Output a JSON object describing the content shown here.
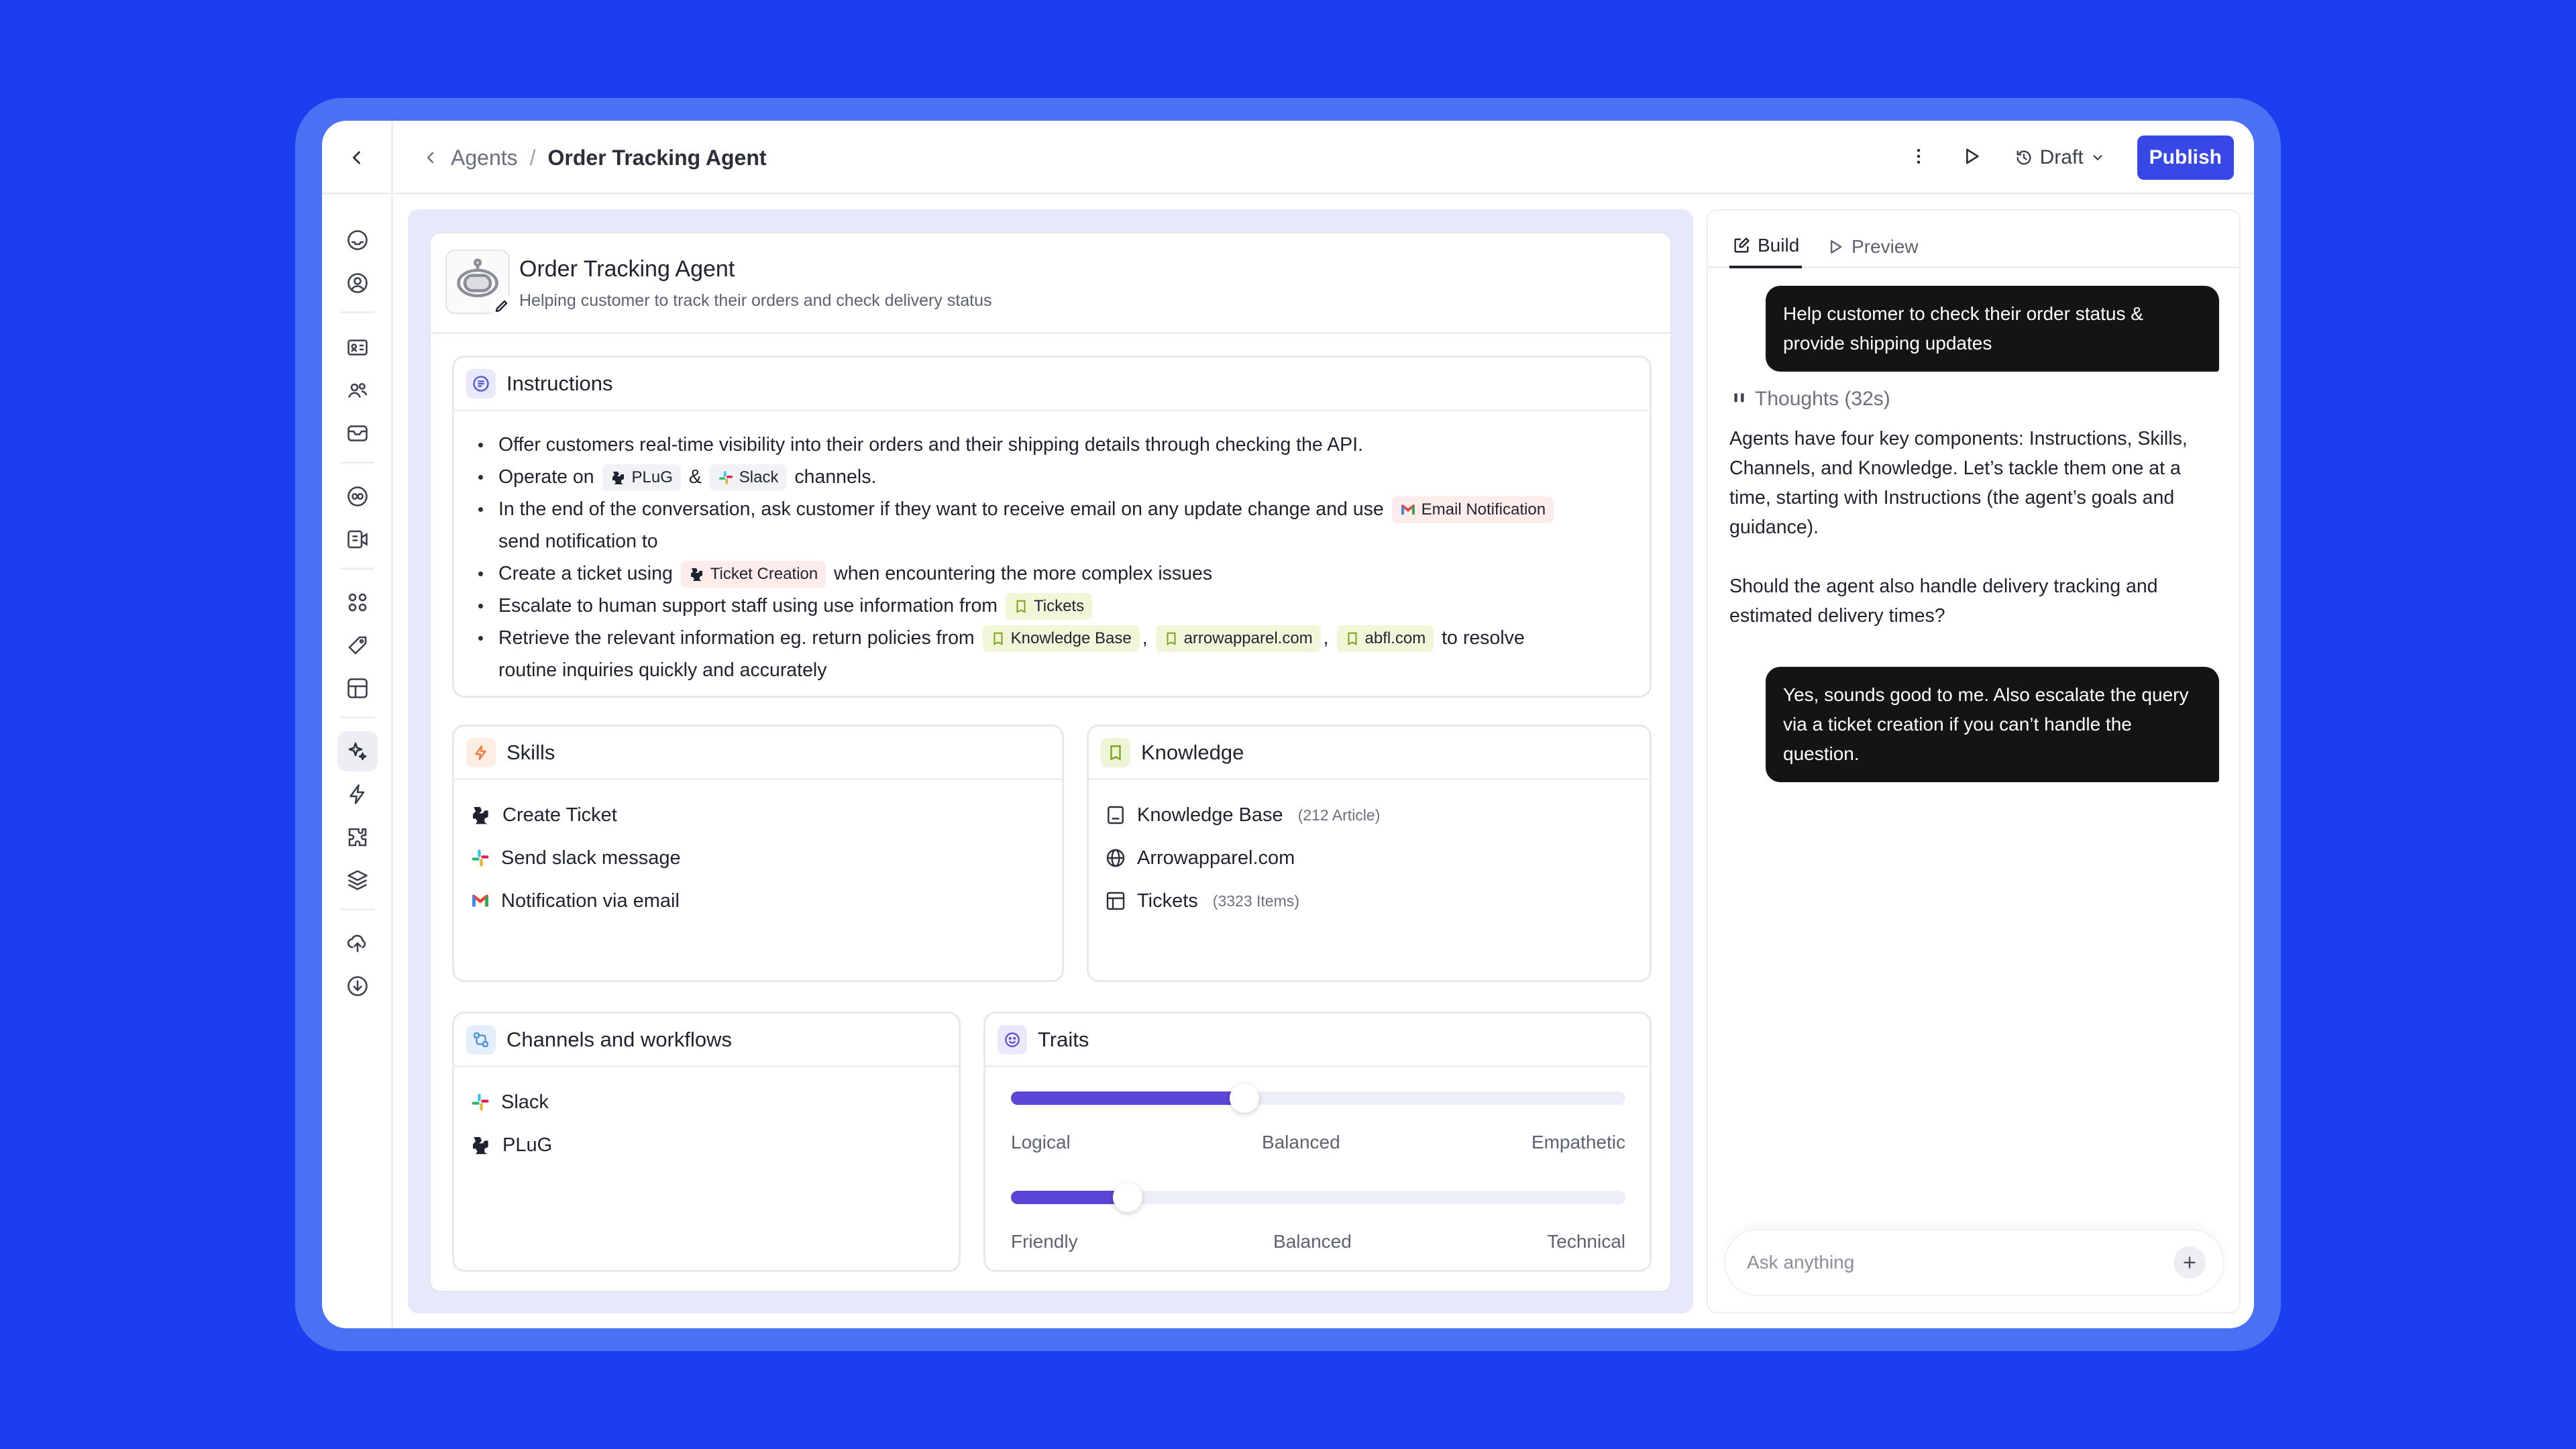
{
  "breadcrumb": {
    "parent": "Agents",
    "separator": "/",
    "current": "Order Tracking Agent"
  },
  "toolbar": {
    "draft_label": "Draft",
    "publish_label": "Publish"
  },
  "agent": {
    "name": "Order Tracking Agent",
    "description": "Helping customer to track their orders and check delivery status"
  },
  "instructions": {
    "title": "Instructions",
    "line1": "Offer customers real-time visibility into their orders and their shipping details through checking the API.",
    "line2_a": "Operate on",
    "line2_chip1": "PLuG",
    "line2_b": "&",
    "line2_chip2": "Slack",
    "line2_c": "channels.",
    "line3_a": "In the end of the conversation, ask customer if they want to receive email on any update change and use",
    "line3_chip": "Email Notification",
    "line3_b": "send notification to",
    "line4_a": "Create a ticket using",
    "line4_chip": "Ticket Creation",
    "line4_b": "when encountering the more complex issues",
    "line5_a": "Escalate to human support staff using use information from",
    "line5_chip": "Tickets",
    "line6_a": "Retrieve the relevant information eg. return policies from",
    "line6_chip1": "Knowledge Base",
    "line6_comma": ",",
    "line6_chip2": "arrowapparel.com",
    "line6_chip3": "abfl.com",
    "line6_b": "to resolve",
    "line6_c": "routine inquiries quickly and accurately"
  },
  "skills": {
    "title": "Skills",
    "items": [
      {
        "label": "Create Ticket",
        "icon": "plug-icon"
      },
      {
        "label": "Send slack message",
        "icon": "slack-icon"
      },
      {
        "label": "Notification via email",
        "icon": "gmail-icon"
      }
    ]
  },
  "knowledge": {
    "title": "Knowledge",
    "items": [
      {
        "label": "Knowledge Base",
        "meta": "(212 Article)",
        "icon": "document-icon"
      },
      {
        "label": "Arrowapparel.com",
        "meta": "",
        "icon": "globe-icon"
      },
      {
        "label": "Tickets",
        "meta": "(3323 Items)",
        "icon": "table-icon"
      }
    ]
  },
  "channels": {
    "title": "Channels and workflows",
    "items": [
      {
        "label": "Slack",
        "icon": "slack-icon"
      },
      {
        "label": "PLuG",
        "icon": "plug-icon"
      }
    ]
  },
  "traits": {
    "title": "Traits",
    "sliders": [
      {
        "value": 0.38,
        "left": "Logical",
        "mid": "Balanced",
        "right": "Empathetic"
      },
      {
        "value": 0.19,
        "left": "Friendly",
        "mid": "Balanced",
        "right": "Technical"
      }
    ]
  },
  "chat": {
    "tab_build": "Build",
    "tab_preview": "Preview",
    "msg1": "Help customer to check their order status & provide shipping updates",
    "thoughts": "Thoughts (32s)",
    "answer_p1": "Agents have four key components: Instructions, Skills, Channels, and Knowledge. Let’s tackle them one at a time, starting with Instructions (the agent’s goals and guidance).",
    "answer_p2": "Should the agent also handle delivery tracking and estimated delivery times?",
    "msg2": "Yes, sounds good to me. Also escalate the query via a ticket creation if you can’t handle the question.",
    "input_placeholder": "Ask anything"
  },
  "colors": {
    "accent": "#3848e6",
    "background": "#1a3ef0",
    "slider_fill": "#5a46d6"
  }
}
